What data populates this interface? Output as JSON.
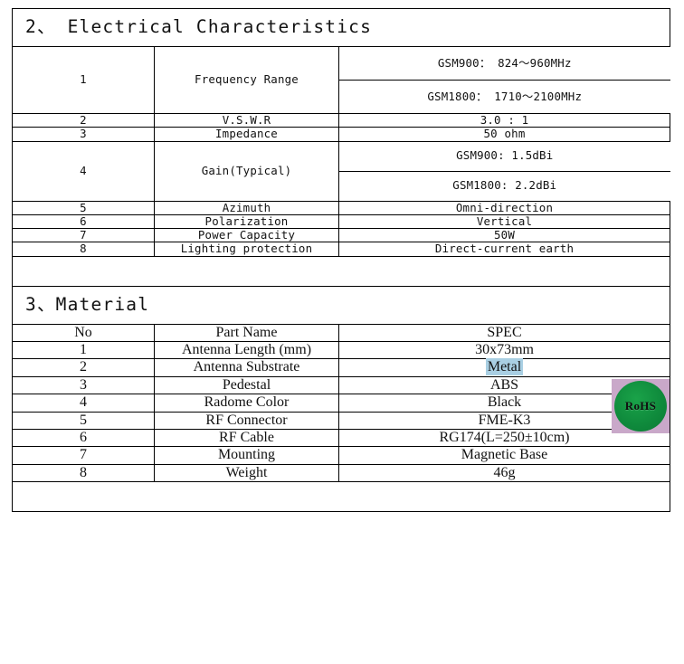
{
  "sections": [
    {
      "heading": "2、 Electrical Characteristics",
      "rows": [
        {
          "no": "1",
          "name": "Frequency Range",
          "spec_lines": [
            "GSM900： 824～960MHz",
            "GSM1800： 1710～2100MHz"
          ]
        },
        {
          "no": "2",
          "name": "V.S.W.R",
          "spec_lines": [
            "3.0 : 1"
          ]
        },
        {
          "no": "3",
          "name": "Impedance",
          "spec_lines": [
            "50 ohm"
          ]
        },
        {
          "no": "4",
          "name": "Gain(Typical)",
          "spec_lines": [
            "GSM900: 1.5dBi",
            "GSM1800: 2.2dBi"
          ]
        },
        {
          "no": "5",
          "name": "Azimuth",
          "spec_lines": [
            "Omni-direction"
          ]
        },
        {
          "no": "6",
          "name": "Polarization",
          "spec_lines": [
            "Vertical"
          ]
        },
        {
          "no": "7",
          "name": "Power Capacity",
          "spec_lines": [
            "50W"
          ]
        },
        {
          "no": "8",
          "name": "Lighting  protection",
          "spec_lines": [
            "Direct-current earth"
          ]
        }
      ]
    },
    {
      "heading": "3、Material",
      "header_row": {
        "no": "No",
        "name": "Part Name",
        "spec": "SPEC"
      },
      "rows": [
        {
          "no": "1",
          "name": "Antenna Length (mm)",
          "spec": "30x73mm"
        },
        {
          "no": "2",
          "name": "Antenna Substrate",
          "spec": "Metal",
          "highlight": true
        },
        {
          "no": "3",
          "name": "Pedestal",
          "spec": "ABS"
        },
        {
          "no": "4",
          "name": "Radome Color",
          "spec": "Black"
        },
        {
          "no": "5",
          "name": "RF Connector",
          "spec": "FME-K3"
        },
        {
          "no": "6",
          "name": "RF Cable",
          "spec": "RG174(L=250±10cm)"
        },
        {
          "no": "7",
          "name": "Mounting",
          "spec": "Magnetic Base"
        },
        {
          "no": "8",
          "name": "Weight",
          "spec": "46g"
        }
      ]
    }
  ],
  "badge": {
    "label": "RoHS",
    "disc_color": "#13913f",
    "backdrop_color": "#c9a8c9"
  },
  "selection_highlight_color": "#a9cfe3"
}
